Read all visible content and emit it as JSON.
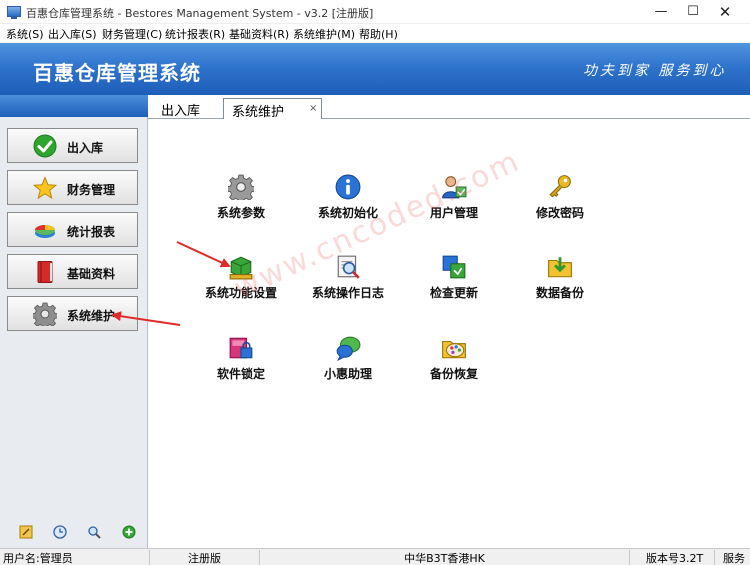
{
  "window": {
    "title": "百惠仓库管理系统 - Bestores Management System - v3.2 [注册版]",
    "controls": {
      "minimize": "—",
      "maximize": "☐",
      "close": "✕"
    }
  },
  "menu": [
    "系统(S)",
    "出入库(S)",
    "财务管理(C)",
    "统计报表(R)",
    "基础资料(R)",
    "系统维护(M)",
    "帮助(H)"
  ],
  "banner": {
    "title": "百惠仓库管理系统",
    "slogan": "功夫到家 服务到心"
  },
  "sidebar": {
    "buttons": [
      {
        "label": "出入库",
        "icon": "green-check-icon"
      },
      {
        "label": "财务管理",
        "icon": "gold-star-icon"
      },
      {
        "label": "统计报表",
        "icon": "pie-chart-icon"
      },
      {
        "label": "基础资料",
        "icon": "red-book-icon"
      },
      {
        "label": "系统维护",
        "icon": "gear-icon"
      }
    ],
    "bottom_icons": [
      "note-icon",
      "clock-icon",
      "search-icon",
      "add-icon"
    ]
  },
  "tabs": [
    {
      "label": "出入库",
      "active": false
    },
    {
      "label": "系统维护",
      "active": true,
      "close": "×"
    }
  ],
  "tiles": [
    {
      "label": "系统参数",
      "icon": "gear-icon"
    },
    {
      "label": "系统初始化",
      "icon": "info-icon"
    },
    {
      "label": "用户管理",
      "icon": "users-icon"
    },
    {
      "label": "修改密码",
      "icon": "key-icon"
    },
    {
      "label": "系统功能设置",
      "icon": "green-box-icon"
    },
    {
      "label": "系统操作日志",
      "icon": "log-magnifier-icon"
    },
    {
      "label": "检查更新",
      "icon": "update-icon"
    },
    {
      "label": "数据备份",
      "icon": "backup-folder-icon"
    },
    {
      "label": "软件锁定",
      "icon": "lock-box-icon"
    },
    {
      "label": "小惠助理",
      "icon": "chat-bubble-icon"
    },
    {
      "label": "备份恢复",
      "icon": "palette-folder-icon"
    }
  ],
  "watermark": "www.cncoded.com",
  "status": {
    "user": "用户名:管理员",
    "edition": "注册版",
    "company": "中华B3T香港HK",
    "version": "版本号3.2T",
    "extra": "服务"
  },
  "colors": {
    "banner": "#2f74cd",
    "sidebar_bg": "#e8ecf1",
    "arrow": "#e02a2a"
  }
}
